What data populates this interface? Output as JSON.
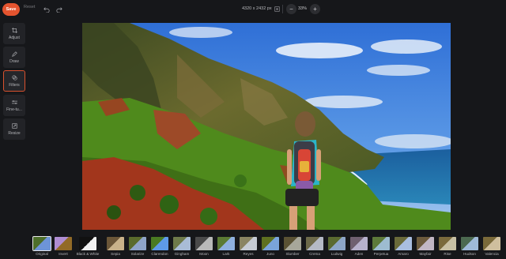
{
  "toolbar": {
    "save_label": "Save",
    "reset_label": "Reset",
    "image_dims": "4320 x 2432 px",
    "zoom": "33%",
    "undo_icon": "undo-icon",
    "redo_icon": "redo-icon"
  },
  "tools": [
    {
      "label": "Adjust",
      "icon": "crop-icon",
      "active": false
    },
    {
      "label": "Draw",
      "icon": "pencil-icon",
      "active": false
    },
    {
      "label": "Filters",
      "icon": "filters-icon",
      "active": true
    },
    {
      "label": "Fine-tu...",
      "icon": "sliders-icon",
      "active": false
    },
    {
      "label": "Resize",
      "icon": "resize-icon",
      "active": false
    }
  ],
  "filters": [
    {
      "label": "Original",
      "active": true
    },
    {
      "label": "Invert"
    },
    {
      "label": "Black & White"
    },
    {
      "label": "Sepia"
    },
    {
      "label": "Solarize"
    },
    {
      "label": "Clarendon"
    },
    {
      "label": "Gingham"
    },
    {
      "label": "Moon"
    },
    {
      "label": "Lark"
    },
    {
      "label": "Reyes"
    },
    {
      "label": "Juno"
    },
    {
      "label": "Slumber"
    },
    {
      "label": "Crema"
    },
    {
      "label": "Ludwig"
    },
    {
      "label": "Aden"
    },
    {
      "label": "Perpetua"
    },
    {
      "label": "Amaro"
    },
    {
      "label": "Mayfair"
    },
    {
      "label": "Rise"
    },
    {
      "label": "Hudson"
    },
    {
      "label": "Valencia"
    }
  ],
  "colors": {
    "accent": "#e4542f",
    "background": "#16171a",
    "panel": "#222327"
  }
}
